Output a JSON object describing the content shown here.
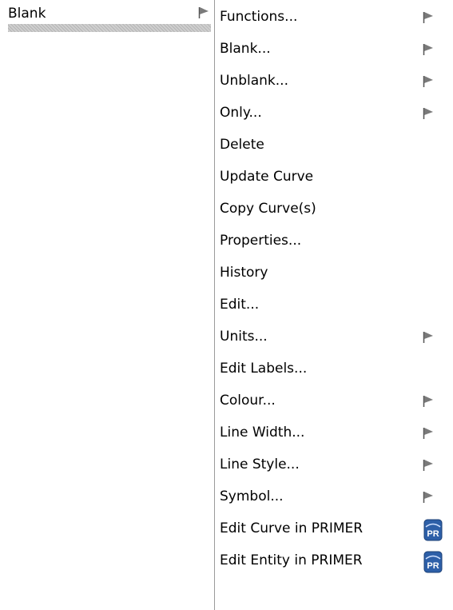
{
  "parent_menu": {
    "label": "Blank",
    "submenu_arrow": "submenu-arrow-icon"
  },
  "submenu": {
    "items": [
      {
        "label": "Functions...",
        "trailing": "arrow"
      },
      {
        "label": "Blank...",
        "trailing": "arrow"
      },
      {
        "label": "Unblank...",
        "trailing": "arrow"
      },
      {
        "label": "Only...",
        "trailing": "arrow"
      },
      {
        "label": "Delete",
        "trailing": "none"
      },
      {
        "label": "Update Curve",
        "trailing": "none"
      },
      {
        "label": "Copy Curve(s)",
        "trailing": "none"
      },
      {
        "label": "Properties...",
        "trailing": "none"
      },
      {
        "label": "History",
        "trailing": "none"
      },
      {
        "label": "Edit...",
        "trailing": "none"
      },
      {
        "label": "Units...",
        "trailing": "arrow"
      },
      {
        "label": "Edit Labels...",
        "trailing": "none"
      },
      {
        "label": "Colour...",
        "trailing": "arrow"
      },
      {
        "label": "Line Width...",
        "trailing": "arrow"
      },
      {
        "label": "Line Style...",
        "trailing": "arrow"
      },
      {
        "label": "Symbol...",
        "trailing": "arrow"
      },
      {
        "label": "Edit Curve in PRIMER",
        "trailing": "primer-icon"
      },
      {
        "label": "Edit Entity in PRIMER",
        "trailing": "primer-icon"
      }
    ]
  },
  "icons": {
    "primer_icon_text": "PR"
  },
  "colors": {
    "text": "#000000",
    "arrow": "#7a7a7a",
    "separator": "#9a9a9a",
    "primer_icon_bg": "#2d5fa8",
    "hatch": "#b5b5b5"
  }
}
